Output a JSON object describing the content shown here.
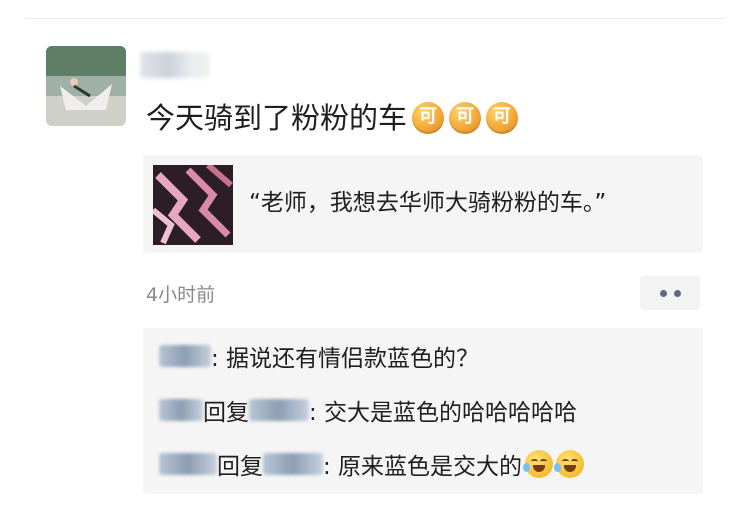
{
  "post": {
    "text": "今天骑到了粉粉的车",
    "emoji_label": "可",
    "emoji_count": 3
  },
  "share": {
    "quote": "“老师，我想去华师大骑粉粉的车。”"
  },
  "meta": {
    "timestamp": "4小时前"
  },
  "comments": [
    {
      "text": ": 据说还有情侣款蓝色的？"
    },
    {
      "reply_word": "回复",
      "text": ": 交大是蓝色的哈哈哈哈哈"
    },
    {
      "reply_word": "回复",
      "text": ": 原来蓝色是交大的"
    }
  ],
  "colors": {
    "emoji_orange": "#f3a838",
    "card_bg": "#f5f5f5",
    "timestamp_gray": "#8a8a8a",
    "more_dots": "#5a6b86"
  }
}
